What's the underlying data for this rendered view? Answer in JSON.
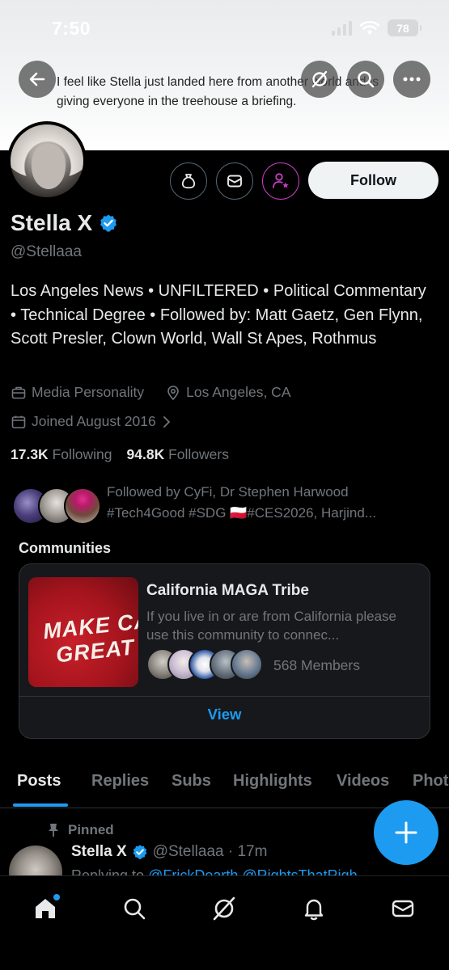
{
  "status_bar": {
    "time": "7:50",
    "battery": "78"
  },
  "banner": {
    "text": "I feel like Stella just landed here from another world and is giving everyone in the treehouse a briefing."
  },
  "profile": {
    "name": "Stella X",
    "handle": "@Stellaaa",
    "bio": "Los Angeles News • UNFILTERED • Political Commentary • Technical Degree • Followed by: Matt Gaetz, Gen Flynn, Scott Presler, Clown World, Wall St Apes, Rothmus",
    "category": "Media Personality",
    "location": "Los Angeles, CA",
    "joined": "Joined August 2016",
    "following_count": "17.3K",
    "following_label": "Following",
    "followers_count": "94.8K",
    "followers_label": "Followers",
    "followed_by_line1": "Followed by CyFi, Dr Stephen Harwood",
    "followed_by_line2": "#Tech4Good #SDG 🇵🇱#CES2026, Harjind...",
    "follow_button": "Follow",
    "verified_color": "#1d9bf0"
  },
  "communities": {
    "title": "Communities",
    "card": {
      "image_text_line1": "MAKE CALI",
      "image_text_line2": "GREAT A",
      "name": "California MAGA Tribe",
      "description": "If you live in or are from California please use this community to connec...",
      "members": "568 Members",
      "view": "View"
    }
  },
  "tabs": [
    {
      "label": "Posts",
      "active": true
    },
    {
      "label": "Replies",
      "active": false
    },
    {
      "label": "Subs",
      "active": false
    },
    {
      "label": "Highlights",
      "active": false
    },
    {
      "label": "Videos",
      "active": false
    },
    {
      "label": "Phot",
      "active": false
    }
  ],
  "pinned_post": {
    "pinned_label": "Pinned",
    "name": "Stella X",
    "handle_time": "@Stellaaa · 17m",
    "preview_prefix": "Replying to ",
    "preview_mentions": "@FrickDearth @RightsThatRigh"
  },
  "icons": {
    "back": "arrow-left-icon",
    "grok": "grok-icon",
    "search": "search-icon",
    "more": "more-icon",
    "tip": "money-bag-icon",
    "message": "envelope-icon",
    "subscribe": "person-star-icon",
    "home": "home-icon",
    "notifications": "bell-icon",
    "compose": "plus-icon"
  },
  "colors": {
    "accent": "#1d9bf0",
    "subscribe_accent": "#c93cc5",
    "background": "#000000"
  }
}
